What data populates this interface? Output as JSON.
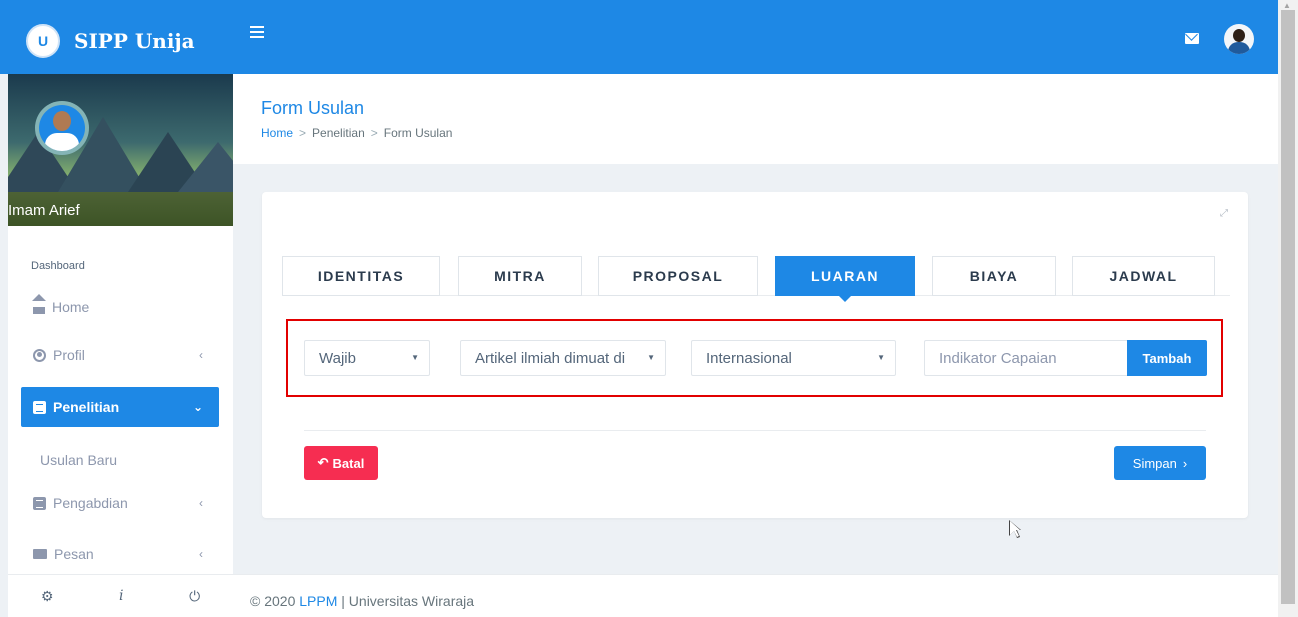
{
  "app": {
    "title": "SIPP Unija",
    "logo_text": "U"
  },
  "sidebar": {
    "user_name": "Imam Arief",
    "section_label": "Dashboard",
    "items": [
      {
        "label": "Home",
        "icon": "home-icon",
        "chevron": ""
      },
      {
        "label": "Profil",
        "icon": "user-circle-icon",
        "chevron": "‹"
      },
      {
        "label": "Penelitian",
        "icon": "document-icon",
        "chevron": "⌄"
      },
      {
        "label": "Pengabdian",
        "icon": "document-icon",
        "chevron": "‹"
      },
      {
        "label": "Pesan",
        "icon": "mail-icon",
        "chevron": "‹"
      }
    ],
    "sub_item": "Usulan Baru",
    "footer_icons": {
      "settings": "⚙",
      "info": "i",
      "power": "⏻"
    }
  },
  "page": {
    "title": "Form Usulan",
    "breadcrumb": {
      "home": "Home",
      "sep": ">",
      "section": "Penelitian",
      "current": "Form Usulan"
    }
  },
  "tabs": [
    "IDENTITAS",
    "MITRA",
    "PROPOSAL",
    "LUARAN",
    "BIAYA",
    "JADWAL"
  ],
  "active_tab": "LUARAN",
  "form": {
    "select_kategori": "Wajib",
    "select_jenis": "Artikel ilmiah dimuat di",
    "select_tingkat": "Internasional",
    "indikator_placeholder": "Indikator Capaian",
    "tambah_label": "Tambah",
    "dropdown_arrow": "▼"
  },
  "actions": {
    "batal_label": "Batal",
    "batal_icon": "↶",
    "simpan_label": "Simpan",
    "simpan_icon": "›"
  },
  "footer": {
    "copyright": "© 2020",
    "org_link": "LPPM",
    "separator": "|",
    "university": "Universitas Wiraraja"
  },
  "colors": {
    "primary": "#1e88e5",
    "danger": "#f62d51",
    "highlight_border": "#e20000"
  }
}
